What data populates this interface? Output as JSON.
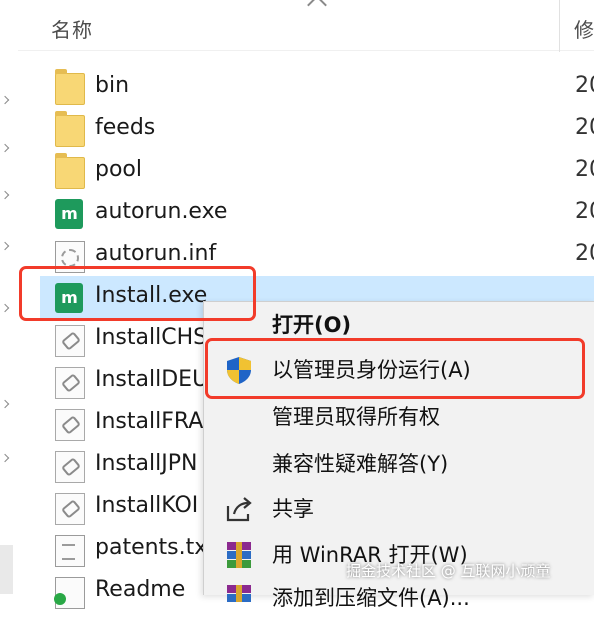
{
  "header": {
    "col_name": "名称",
    "col_date": "修"
  },
  "files": [
    {
      "name": "bin",
      "date": "20",
      "icon": "folder-icon"
    },
    {
      "name": "feeds",
      "date": "20",
      "icon": "folder-icon"
    },
    {
      "name": "pool",
      "date": "20",
      "icon": "folder-icon"
    },
    {
      "name": "autorun.exe",
      "date": "20",
      "icon": "app-exe-icon"
    },
    {
      "name": "autorun.inf",
      "date": "20",
      "icon": "settings-file-icon"
    },
    {
      "name": "Install.exe",
      "date": "",
      "icon": "app-exe-icon"
    },
    {
      "name": "InstallCHS",
      "date": "",
      "icon": "setup-file-icon"
    },
    {
      "name": "InstallDEU",
      "date": "",
      "icon": "setup-file-icon"
    },
    {
      "name": "InstallFRA",
      "date": "",
      "icon": "setup-file-icon"
    },
    {
      "name": "InstallJPN",
      "date": "",
      "icon": "setup-file-icon"
    },
    {
      "name": "InstallKOI",
      "date": "",
      "icon": "setup-file-icon"
    },
    {
      "name": "patents.tx",
      "date": "",
      "icon": "text-file-icon"
    },
    {
      "name": "Readme",
      "date": "",
      "icon": "readme-file-icon"
    }
  ],
  "exe_icon_glyph": "m",
  "context_menu": {
    "open": "打开(O)",
    "run_as_admin": "以管理员身份运行(A)",
    "take_ownership": "管理员取得所有权",
    "compat": "兼容性疑难解答(Y)",
    "share": "共享",
    "winrar_open": "用 WinRAR 打开(W)",
    "add_archive": "添加到压缩文件(A)..."
  },
  "watermark": "掘金技术社区 @ 互联网小顽童",
  "colors": {
    "selection": "#cce8ff",
    "highlight_border": "#f23b2a",
    "menu_bg": "#f2f2f2",
    "exe_green": "#1e9a5c",
    "folder_yellow": "#f8d775"
  }
}
